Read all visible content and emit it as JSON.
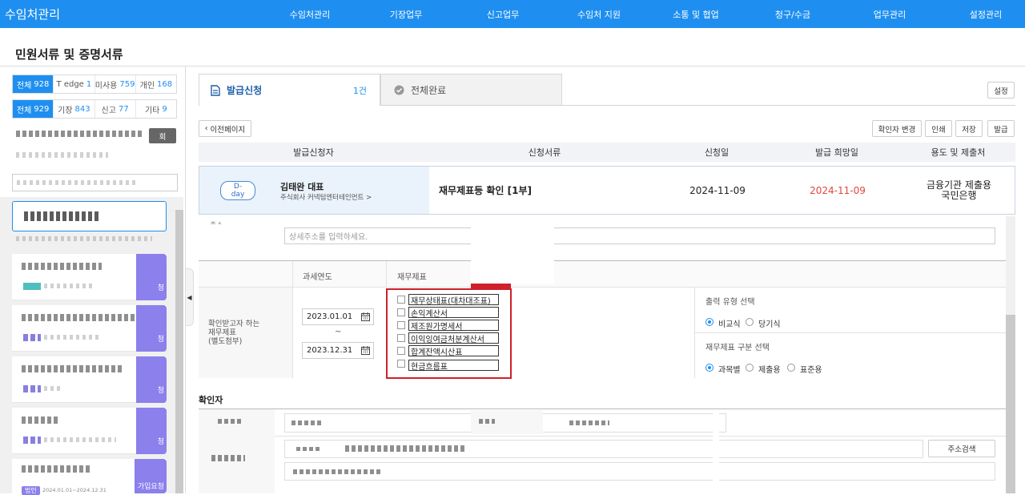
{
  "app": {
    "brand": "수임처관리",
    "nav": [
      "수임처관리",
      "기장업무",
      "신고업무",
      "수임처 지원",
      "소통 및 협업",
      "청구/수금",
      "업무관리",
      "설정관리"
    ]
  },
  "page_title": "민원서류 및 증명서류",
  "sidebar": {
    "filters_row1": [
      {
        "label": "전체",
        "count": "928"
      },
      {
        "label": "T edge",
        "count": "1"
      },
      {
        "label": "미사용",
        "count": "759"
      },
      {
        "label": "개인",
        "count": "168"
      }
    ],
    "filters_row2": [
      {
        "label": "전체",
        "count": "929"
      },
      {
        "label": "기장",
        "count": "843"
      },
      {
        "label": "신고",
        "count": "77"
      },
      {
        "label": "기타",
        "count": "9"
      }
    ],
    "card_tags": [
      "청",
      "청",
      "청",
      "청",
      "가입요청"
    ],
    "small_badge": "회",
    "bottom_badge": "법인",
    "bottom_period": "2024.01.01~2024.12.31"
  },
  "tabs": {
    "active": {
      "label": "발급신청",
      "count": "1건"
    },
    "inactive": {
      "label": "전체완료"
    }
  },
  "toolbar": {
    "settings": "설정",
    "back": "이전페이지",
    "confirm_change": "확인자 변경",
    "print": "인쇄",
    "save": "저장",
    "issue": "발급"
  },
  "table": {
    "headers": [
      "발급신청자",
      "신청서류",
      "신청일",
      "발급 희망일",
      "용도 및 제출처"
    ],
    "row": {
      "dday": "D-day",
      "applicant_name": "김태완 대표",
      "applicant_company": "주식회사 커넥텀엔터테인먼트 >",
      "document": "재무제표등 확인 [1부]",
      "apply_date": "2024-11-09",
      "hope_date": "2024-11-09",
      "purpose_line1": "금융기관 제출용",
      "purpose_line2": "국민은행"
    }
  },
  "form": {
    "address_placeholder": "상세주소를 입력하세요.",
    "address_label_fragment": "주소",
    "col_tax_year": "과세연도",
    "col_financial": "재무제표",
    "left_label_line1": "확인받고자 하는",
    "left_label_line2": "재무제표",
    "left_label_line3": "(별도첨부)",
    "date_from": "2023.01.01",
    "date_tilde": "~",
    "date_to": "2023.12.31",
    "statements": [
      "재무상태표(대차대조표)",
      "손익계산서",
      "제조원가명세서",
      "이익잉여금처분계산서",
      "합계잔액시산표",
      "현금흐름표"
    ],
    "output_type_label": "출력 유형 선택",
    "output_types": [
      "비교식",
      "당기식"
    ],
    "classification_label": "재무제표 구분 선택",
    "classifications": [
      "과목별",
      "제출용",
      "표준용"
    ],
    "confirmer_title": "확인자",
    "address_search": "주소검색"
  },
  "colors": {
    "primary": "#1e8ff0",
    "highlight_border": "#d0202a",
    "hope_date": "#e0483f",
    "card_tag": "#8b80ec"
  }
}
